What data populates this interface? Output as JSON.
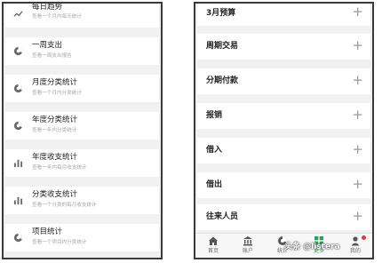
{
  "left": {
    "items": [
      {
        "title": "每日趋势",
        "subtitle": "查看一个月内每天统计",
        "icon": "trend-line-icon"
      },
      {
        "title": "一周支出",
        "subtitle": "查看一周支出报告",
        "icon": "pie-chart-icon"
      },
      {
        "title": "月度分类统计",
        "subtitle": "查看一个月内分类统计",
        "icon": "pie-chart-icon"
      },
      {
        "title": "年度分类统计",
        "subtitle": "查看一年内分类统计",
        "icon": "pie-chart-icon"
      },
      {
        "title": "年度收支统计",
        "subtitle": "查看一年内每月收支统计",
        "icon": "bar-chart-icon"
      },
      {
        "title": "分类收支统计",
        "subtitle": "查看一个分类的每月收支统计",
        "icon": "bar-chart-icon"
      },
      {
        "title": "项目统计",
        "subtitle": "查看一个项目内分类统计",
        "icon": "pie-chart-icon"
      }
    ]
  },
  "right": {
    "items": [
      {
        "title": "3月预算"
      },
      {
        "title": "周期交易"
      },
      {
        "title": "分期付款"
      },
      {
        "title": "报销"
      },
      {
        "title": "借入"
      },
      {
        "title": "借出"
      },
      {
        "title": "往来人员"
      }
    ],
    "plus_glyph": "+",
    "tabs": [
      {
        "label": "首页",
        "icon": "home-icon"
      },
      {
        "label": "账户",
        "icon": "bank-icon"
      },
      {
        "label": "统计",
        "icon": "pie-chart-icon"
      },
      {
        "label": "更多",
        "icon": "grid-icon"
      },
      {
        "label": "我的",
        "icon": "person-icon"
      }
    ]
  },
  "watermark": "头条 @listera",
  "colors": {
    "accent": "#2a9d5c",
    "icon_gray": "#666666",
    "badge": "#e53935"
  }
}
